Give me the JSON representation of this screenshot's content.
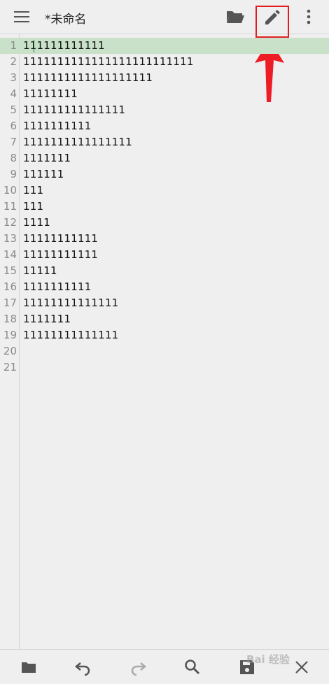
{
  "toolbar": {
    "title": "*未命名",
    "icons": {
      "menu": "hamburger-menu-icon",
      "open": "folder-open-icon",
      "edit": "pencil-icon",
      "more": "more-vert-icon"
    }
  },
  "editor": {
    "current_line": 1,
    "lines": [
      {
        "num": "1",
        "text": "111111111111"
      },
      {
        "num": "2",
        "text": "1111111111111111111111111"
      },
      {
        "num": "3",
        "text": "1111111111111111111"
      },
      {
        "num": "4",
        "text": "11111111"
      },
      {
        "num": "5",
        "text": "111111111111111"
      },
      {
        "num": "6",
        "text": "1111111111"
      },
      {
        "num": "7",
        "text": "1111111111111111"
      },
      {
        "num": "8",
        "text": "1111111"
      },
      {
        "num": "9",
        "text": "111111"
      },
      {
        "num": "10",
        "text": "111"
      },
      {
        "num": "11",
        "text": "111"
      },
      {
        "num": "12",
        "text": "1111"
      },
      {
        "num": "13",
        "text": "11111111111"
      },
      {
        "num": "14",
        "text": "11111111111"
      },
      {
        "num": "15",
        "text": "11111"
      },
      {
        "num": "16",
        "text": "1111111111"
      },
      {
        "num": "17",
        "text": "11111111111111"
      },
      {
        "num": "18",
        "text": "1111111"
      },
      {
        "num": "19",
        "text": "11111111111111"
      },
      {
        "num": "20",
        "text": ""
      },
      {
        "num": "21",
        "text": ""
      }
    ]
  },
  "bottom_toolbar": {
    "icons": [
      "folder-icon",
      "undo-icon",
      "redo-icon",
      "search-icon",
      "save-icon",
      "close-icon"
    ]
  },
  "watermark": "Bai 经验",
  "colors": {
    "current_line": "#c9e0c9",
    "annotation": "#e02020",
    "background": "#efefef"
  }
}
